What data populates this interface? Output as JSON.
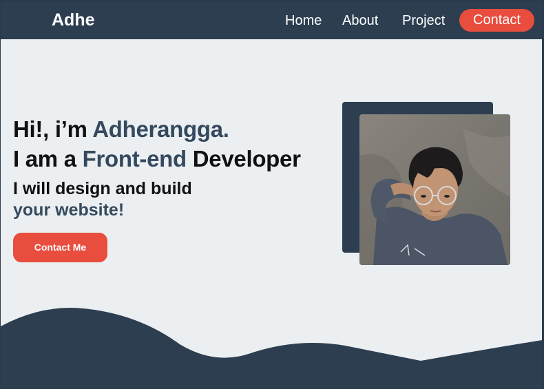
{
  "nav": {
    "brand": "Adhe",
    "links": [
      "Home",
      "About",
      "Project"
    ],
    "contact_label": "Contact"
  },
  "hero": {
    "line1_prefix": "Hi!, i’m ",
    "line1_name": "Adherangga.",
    "line2_prefix": "I am a ",
    "line2_role": "Front-end",
    "line2_suffix": " Developer",
    "sub_line1": "I will design and build",
    "sub_line2": "your website!",
    "cta_label": "Contact Me"
  },
  "colors": {
    "navbar": "#2c3e50",
    "accent_text": "#34495e",
    "button": "#e84d3d",
    "background": "#eceff1"
  },
  "icons": {
    "profile": "profile-photo"
  }
}
